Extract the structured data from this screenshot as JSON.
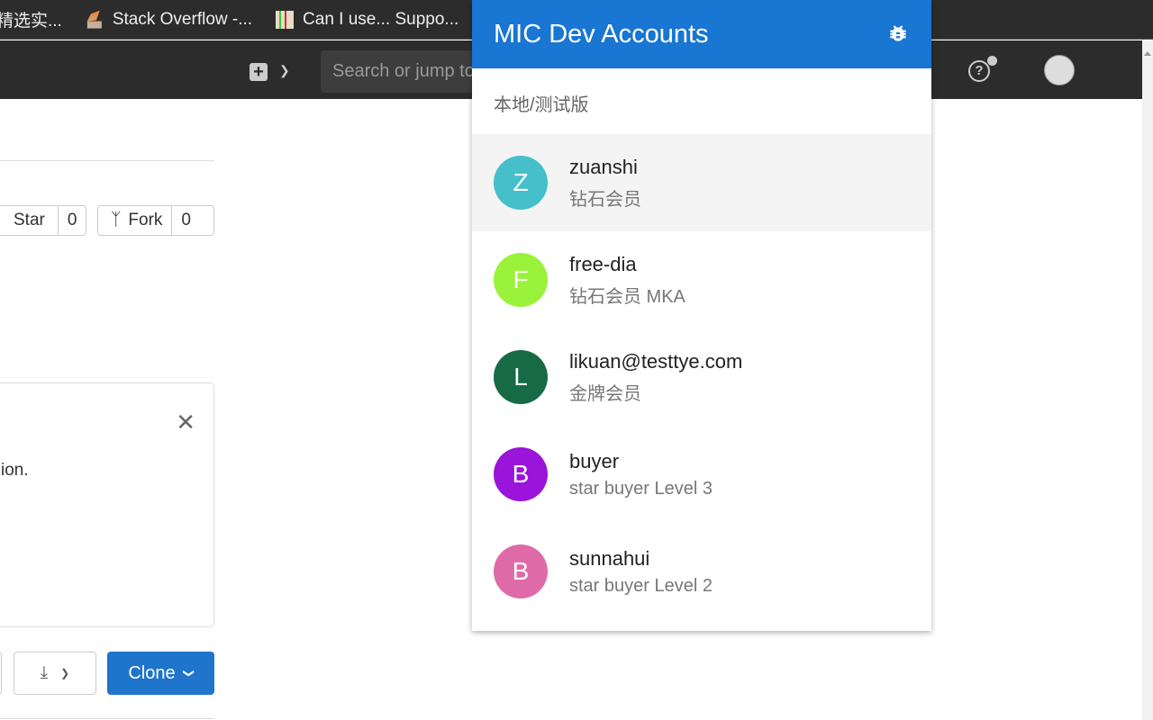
{
  "bookmarks": [
    {
      "label": "精选实...",
      "icon": "bookmark-icon"
    },
    {
      "label": "Stack Overflow -...",
      "icon": "stackoverflow-icon"
    },
    {
      "label": "Can I use... Suppo...",
      "icon": "caniuse-icon"
    }
  ],
  "nav": {
    "search_placeholder": "Search or jump to...",
    "new_icon": "plus-square-icon",
    "help_icon": "question-circle-icon",
    "user_icon": "avatar-icon"
  },
  "repo": {
    "star_label": "Star",
    "star_count": "0",
    "fork_label": "Fork",
    "fork_count": "0",
    "alert_text": "ion.",
    "close_icon": "close-icon",
    "download_icon": "download-icon",
    "clone_label": "Clone"
  },
  "popup": {
    "title": "MIC Dev Accounts",
    "icon": "bug-icon",
    "environment": "本地/测试版",
    "accent": "#1976d2",
    "accounts": [
      {
        "initial": "Z",
        "name": "zuanshi",
        "desc": "钻石会员",
        "color": "#45bfc9",
        "selected": true
      },
      {
        "initial": "F",
        "name": "free-dia",
        "desc": "钻石会员 MKA",
        "color": "#9af23a"
      },
      {
        "initial": "L",
        "name": "likuan@testtye.com",
        "desc": "金牌会员",
        "color": "#166b45"
      },
      {
        "initial": "B",
        "name": "buyer",
        "desc": "star buyer Level 3",
        "color": "#9a14d9"
      },
      {
        "initial": "B",
        "name": "sunnahui",
        "desc": "star buyer Level 2",
        "color": "#de6ba8"
      }
    ]
  }
}
